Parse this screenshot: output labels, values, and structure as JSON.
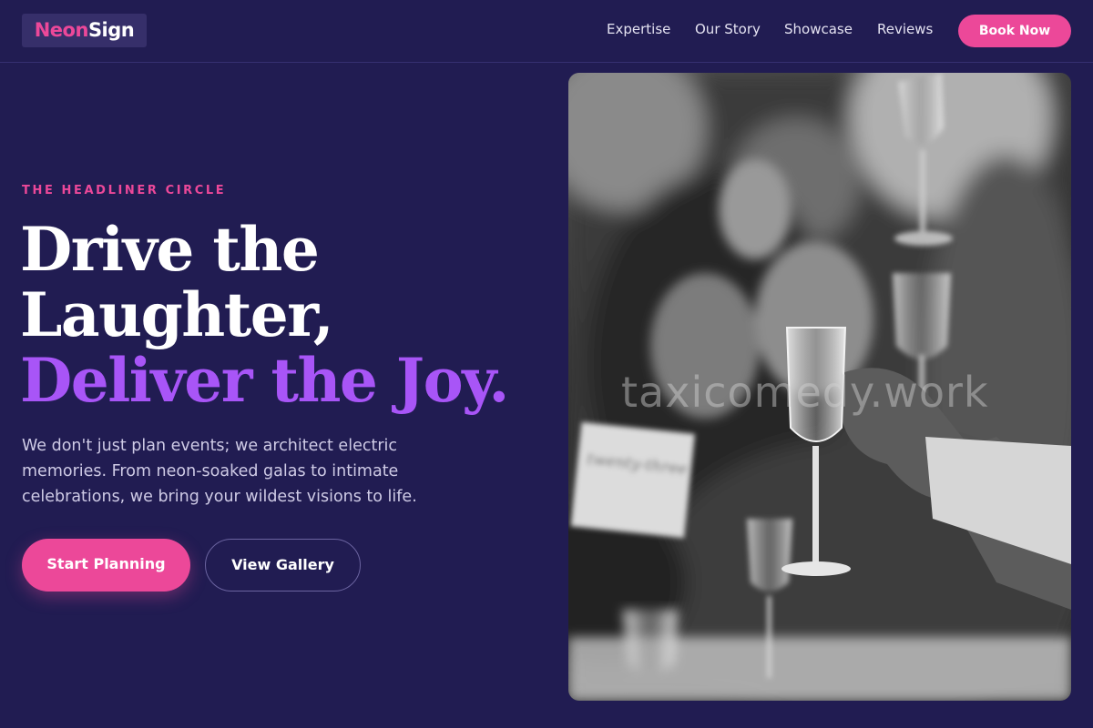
{
  "brand": {
    "name_part1": "Neon",
    "name_part2": "Sign"
  },
  "nav": {
    "links": [
      "Expertise",
      "Our Story",
      "Showcase",
      "Reviews"
    ],
    "cta": "Book Now"
  },
  "hero": {
    "eyebrow": "THE HEADLINER CIRCLE",
    "headline_line1": "Drive the",
    "headline_line2": "Laughter,",
    "headline_accent": "Deliver the Joy.",
    "description": "We don't just plan events; we architect electric memories. From neon-soaked galas to intimate celebrations, we bring your wildest visions to life.",
    "primary_button": "Start Planning",
    "secondary_button": "View Gallery",
    "image_watermark": "taxicomedy.work"
  },
  "colors": {
    "background": "#211c52",
    "accent_pink": "#ec4899",
    "accent_purple": "#a855f7"
  },
  "icons": {
    "image_subject": "celebration-toast-photo"
  }
}
